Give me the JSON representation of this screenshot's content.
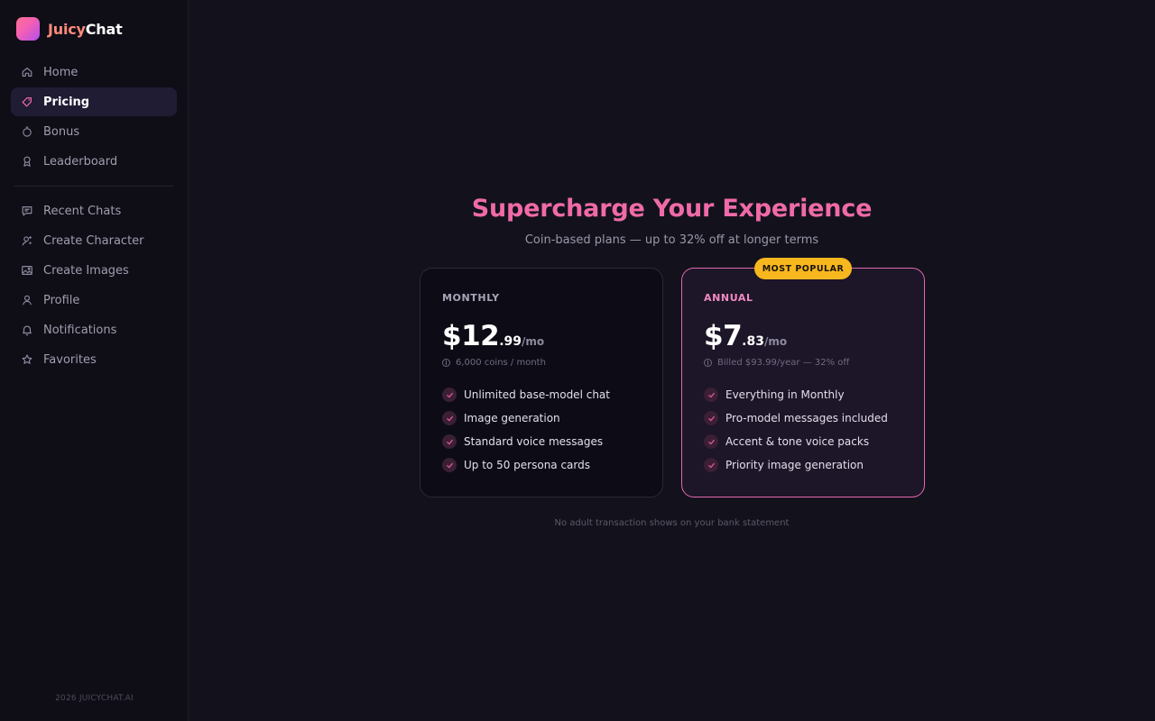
{
  "brand": {
    "name_part1": "Juicy",
    "name_part2": "Chat"
  },
  "sidebar": {
    "primary": [
      {
        "label": "Home",
        "icon": "home-icon"
      },
      {
        "label": "Pricing",
        "icon": "tag-icon",
        "active": true
      },
      {
        "label": "Bonus",
        "icon": "stopwatch-icon"
      },
      {
        "label": "Leaderboard",
        "icon": "award-icon"
      }
    ],
    "secondary": [
      {
        "label": "Recent Chats",
        "icon": "chat-icon"
      },
      {
        "label": "Create Character",
        "icon": "user-sparkle-icon"
      },
      {
        "label": "Create Images",
        "icon": "image-icon"
      },
      {
        "label": "Profile",
        "icon": "user-icon"
      },
      {
        "label": "Notifications",
        "icon": "bell-icon"
      },
      {
        "label": "Favorites",
        "icon": "star-icon"
      }
    ],
    "copyright": "2026 JUICYCHAT.AI"
  },
  "hero": {
    "title": "Supercharge Your Experience",
    "subtitle": "Coin-based plans — up to 32% off at longer terms"
  },
  "plans": [
    {
      "name": "MONTHLY",
      "price_whole": "$12",
      "price_cents": ".99",
      "price_period": "/mo",
      "meta": "6,000 coins / month",
      "features": [
        "Unlimited base-model chat",
        "Image generation",
        "Standard voice messages",
        "Up to 50 persona cards"
      ]
    },
    {
      "name": "ANNUAL",
      "badge": "MOST POPULAR",
      "price_whole": "$7",
      "price_cents": ".83",
      "price_period": "/mo",
      "meta": "Billed $93.99/year — 32% off",
      "features": [
        "Everything in Monthly",
        "Pro-model messages included",
        "Accent & tone voice packs",
        "Priority image generation"
      ]
    }
  ],
  "footnote": "No adult transaction shows on your bank statement",
  "colors": {
    "accent": "#f06aa8",
    "badge": "#f7b71f",
    "background": "#13121c",
    "sidebar": "#0f0e17"
  }
}
